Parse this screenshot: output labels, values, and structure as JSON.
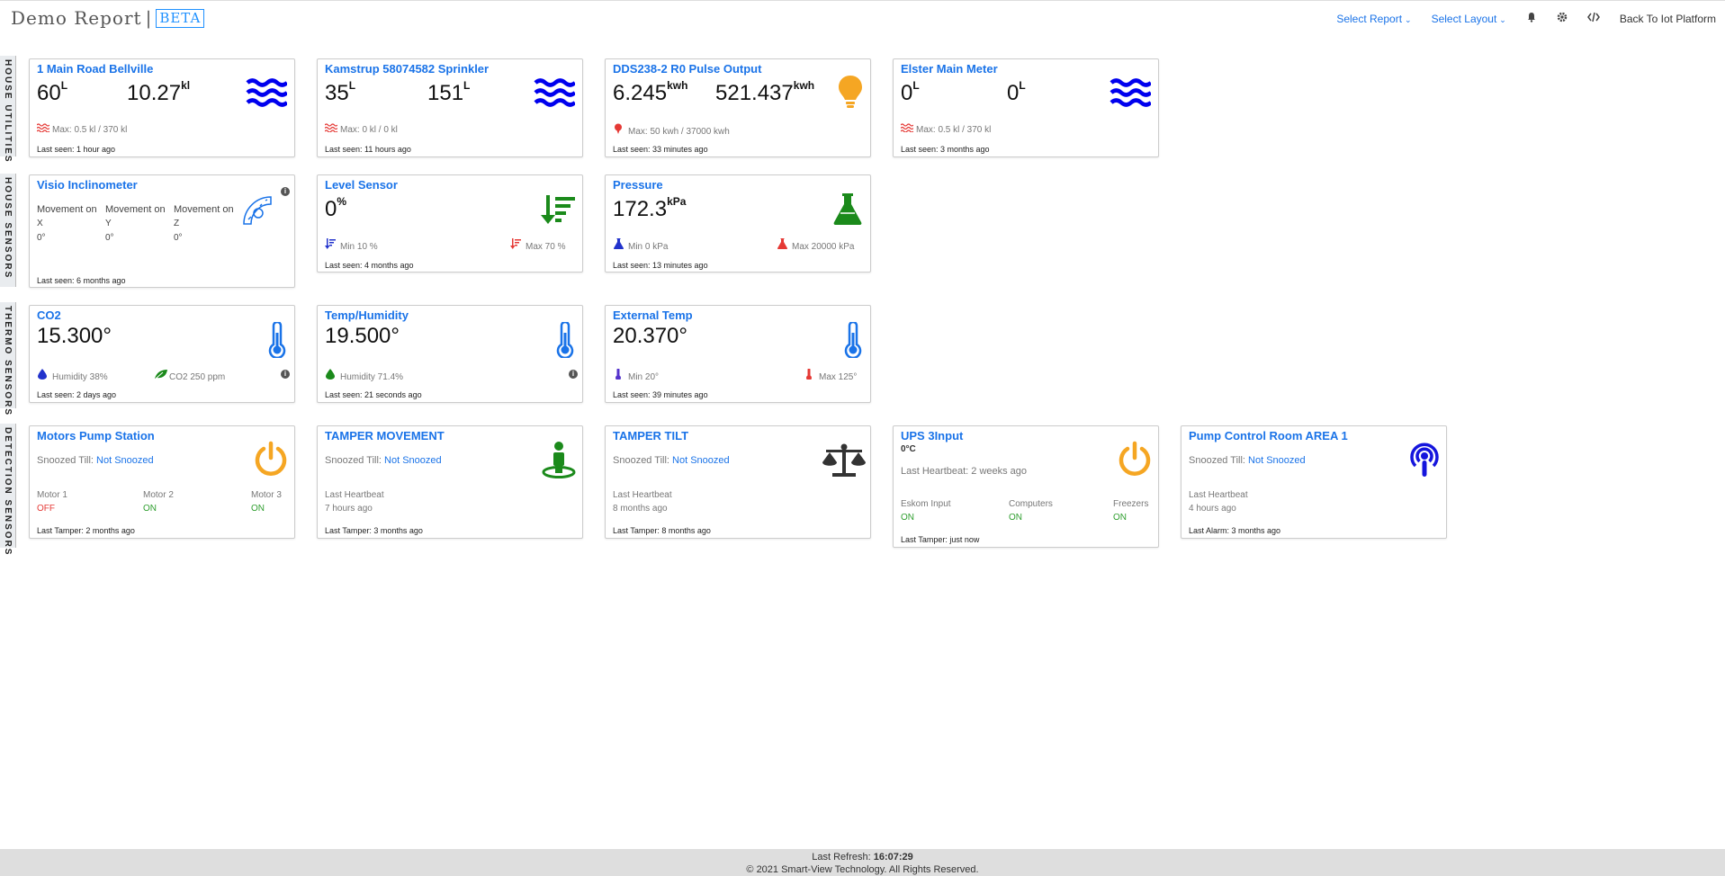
{
  "header": {
    "title": "Demo Report",
    "separator": "|",
    "badge": "BETA",
    "select_report": "Select Report",
    "select_layout": "Select Layout",
    "back_link": "Back To Iot Platform"
  },
  "sections": [
    {
      "label": "HOUSE UTILITIES"
    },
    {
      "label": "HOUSE SENSORS"
    },
    {
      "label": "THERMO SENSORS"
    },
    {
      "label": "DETECTION SENSORS"
    }
  ],
  "utilities": [
    {
      "title": "1 Main Road Bellville",
      "v1": "60",
      "u1": "L",
      "v2": "10.27",
      "u2": "kl",
      "sub": "Max: 0.5 kl / 370 kl",
      "seen": "Last seen: 1 hour ago"
    },
    {
      "title": "Kamstrup 58074582 Sprinkler",
      "v1": "35",
      "u1": "L",
      "v2": "151",
      "u2": "L",
      "sub": "Max: 0 kl / 0 kl",
      "seen": "Last seen: 11 hours ago"
    },
    {
      "title": "DDS238-2 R0 Pulse Output",
      "v1": "6.245",
      "u1": "kwh",
      "v2": "521.437",
      "u2": "kwh",
      "sub": "Max: 50 kwh / 37000 kwh",
      "seen": "Last seen: 33 minutes ago"
    },
    {
      "title": "Elster Main Meter",
      "v1": "0",
      "u1": "L",
      "v2": "0",
      "u2": "L",
      "sub": "Max: 0.5 kl / 370 kl",
      "seen": "Last seen: 3 months ago"
    }
  ],
  "inclinometer": {
    "title": "Visio Inclinometer",
    "movement": [
      "Movement on",
      "Movement on",
      "Movement on"
    ],
    "axes": [
      "X",
      "Y",
      "Z"
    ],
    "values": [
      "0°",
      "0°",
      "0°"
    ],
    "seen": "Last seen: 6 months ago"
  },
  "level": {
    "title": "Level Sensor",
    "value": "0",
    "unit": "%",
    "min": "Min 10 %",
    "max": "Max 70 %",
    "seen": "Last seen: 4 months ago"
  },
  "pressure": {
    "title": "Pressure",
    "value": "172.3",
    "unit": "kPa",
    "min": "Min 0 kPa",
    "max": "Max 20000 kPa",
    "seen": "Last seen: 13 minutes ago"
  },
  "thermo": [
    {
      "title": "CO2",
      "value": "15.300°",
      "left": "Humidity 38%",
      "right": "CO2 250 ppm",
      "seen": "Last seen: 2 days ago"
    },
    {
      "title": "Temp/Humidity",
      "value": "19.500°",
      "left": "Humidity 71.4%",
      "right": "",
      "seen": "Last seen: 21 seconds ago"
    },
    {
      "title": "External Temp",
      "value": "20.370°",
      "left": "Min 20°",
      "right": "Max 125°",
      "seen": "Last seen: 39 minutes ago"
    }
  ],
  "detection": {
    "snoozed_label": "Snoozed Till:",
    "not_snoozed": "Not Snoozed",
    "heartbeat_label": "Last Heartbeat",
    "pump": {
      "title": "Motors Pump Station",
      "motors": [
        "Motor 1",
        "Motor 2",
        "Motor 3"
      ],
      "states": [
        "OFF",
        "ON",
        "ON"
      ],
      "seen": "Last Tamper: 2 months ago"
    },
    "tamper_movement": {
      "title": "TAMPER MOVEMENT",
      "heartbeat": "7 hours ago",
      "seen": "Last Tamper: 3 months ago"
    },
    "tamper_tilt": {
      "title": "TAMPER TILT",
      "heartbeat": "8 months ago",
      "seen": "Last Tamper: 8 months ago"
    },
    "ups": {
      "title": "UPS 3Input",
      "temp": "0°C",
      "heartbeat": "Last Heartbeat: 2 weeks ago",
      "inputs": [
        "Eskom Input",
        "Computers",
        "Freezers"
      ],
      "states": [
        "ON",
        "ON",
        "ON"
      ],
      "seen": "Last Tamper: just now"
    },
    "pump_control": {
      "title": "Pump Control Room AREA 1",
      "heartbeat": "4 hours ago",
      "seen": "Last Alarm: 3 months ago"
    }
  },
  "footer": {
    "refresh_label": "Last Refresh:",
    "refresh_time": "16:07:29",
    "copyright": "© 2021 Smart-View Technology. All Rights Reserved."
  },
  "colors": {
    "accent": "#1a73e8",
    "water_icon": "#0000ee",
    "bulb": "#f5a623",
    "green": "#1b8a1b",
    "red": "#e53935"
  }
}
